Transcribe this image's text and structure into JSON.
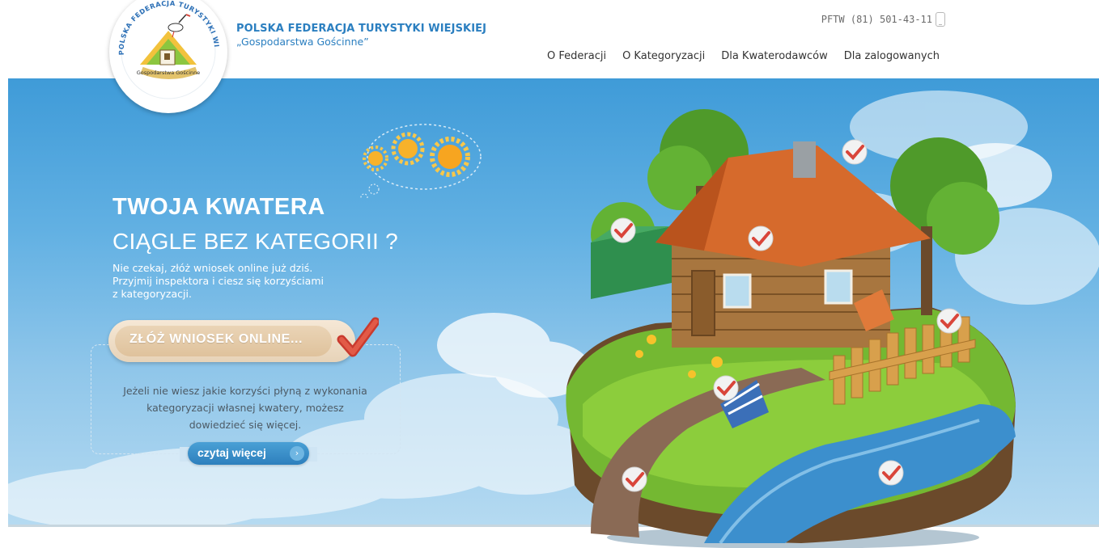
{
  "header": {
    "org_name": "POLSKA FEDERACJA TURYSTYKI WIEJSKIEJ",
    "org_subtitle": "„Gospodarstwa Gościnne”",
    "logo_arc_text": "POLSKA FEDERACJA TURYSTYKI WIEJSKIEJ",
    "logo_bottom_text": "Gospodarstwa Gościnne",
    "phone": "PFTW (81) 501-43-11",
    "nav": [
      {
        "label": "O Federacji"
      },
      {
        "label": "O Kategoryzacji"
      },
      {
        "label": "Dla Kwaterodawców"
      },
      {
        "label": "Dla zalogowanych"
      }
    ]
  },
  "hero": {
    "headline_bold": "TWOJA KWATERA",
    "headline_light": "CIĄGLE BEZ KATEGORII ?",
    "description_lines": [
      "Nie czekaj, złóż wniosek online już dziś.",
      "Przyjmij inspektora i ciesz się korzyściami",
      "z kategoryzacji."
    ],
    "cta_label": "ZŁÓŻ WNIOSEK ONLINE...",
    "info_lines": [
      "Jeżeli nie wiesz jakie korzyści płyną z wykonania",
      "kategoryzacji własnej kwatery, możesz",
      "dowiedzieć się więcej."
    ],
    "read_more_label": "czytaj więcej",
    "colors": {
      "brand_blue": "#2b7fc0",
      "check_red": "#d9453a",
      "sky": "#63b1e3"
    }
  }
}
